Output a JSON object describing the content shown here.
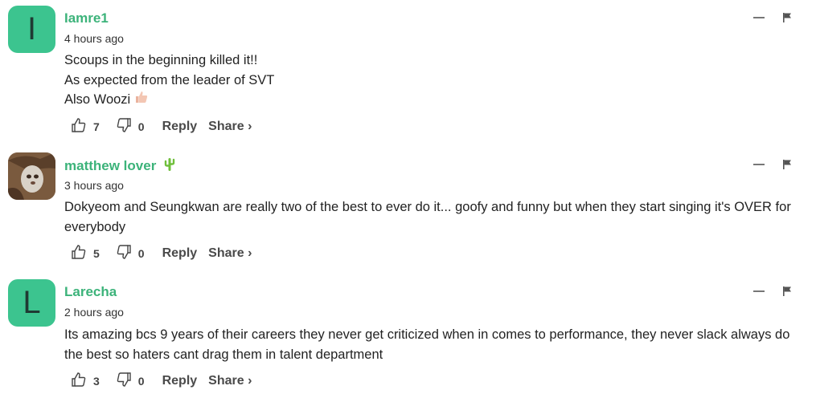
{
  "comments": [
    {
      "avatar_letter": "I",
      "avatar_type": "letter",
      "username": "Iamre1",
      "time": "4 hours ago",
      "lines": [
        "Scoups in the beginning killed it!!",
        "As expected from the leader of SVT",
        "Also Woozi"
      ],
      "emoji": "thumbs-up-light-skin-icon",
      "likes": "7",
      "dislikes": "0",
      "reply_label": "Reply",
      "share_label": "Share ›"
    },
    {
      "avatar_letter": "",
      "avatar_type": "photo",
      "username": "matthew lover",
      "username_emoji": "cactus-icon",
      "time": "3 hours ago",
      "lines": [
        "Dokyeom and Seungkwan are really two of the best to ever do it... goofy and funny but when they start singing it's OVER for everybody"
      ],
      "likes": "5",
      "dislikes": "0",
      "reply_label": "Reply",
      "share_label": "Share ›"
    },
    {
      "avatar_letter": "L",
      "avatar_type": "letter",
      "username": "Larecha",
      "time": "2 hours ago",
      "lines": [
        "Its amazing bcs 9 years of their careers they never get criticized when in comes to performance, they never slack always do the best so haters cant drag them in talent department"
      ],
      "likes": "3",
      "dislikes": "0",
      "reply_label": "Reply",
      "share_label": "Share ›"
    }
  ],
  "colors": {
    "accent": "#3cb37a",
    "avatar_bg": "#3cc48f"
  }
}
